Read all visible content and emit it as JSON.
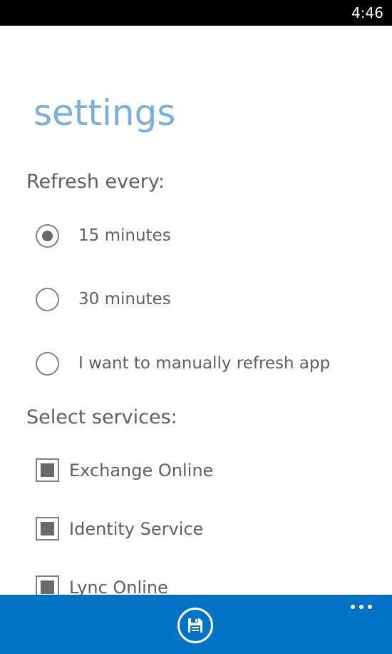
{
  "status_bar": {
    "time": "4:46"
  },
  "page": {
    "title": "settings"
  },
  "refresh": {
    "label": "Refresh every:",
    "options": [
      {
        "label": "15 minutes",
        "selected": true
      },
      {
        "label": "30 minutes",
        "selected": false
      },
      {
        "label": "I want to manually refresh app",
        "selected": false
      }
    ]
  },
  "services": {
    "label": "Select services:",
    "items": [
      {
        "label": "Exchange Online",
        "checked": true
      },
      {
        "label": "Identity Service",
        "checked": true
      },
      {
        "label": "Lync Online",
        "checked": true
      }
    ]
  },
  "app_bar": {
    "background_color": "#0072c6",
    "save_icon": "floppy-disk-icon",
    "more_icon": "ellipsis-icon"
  }
}
